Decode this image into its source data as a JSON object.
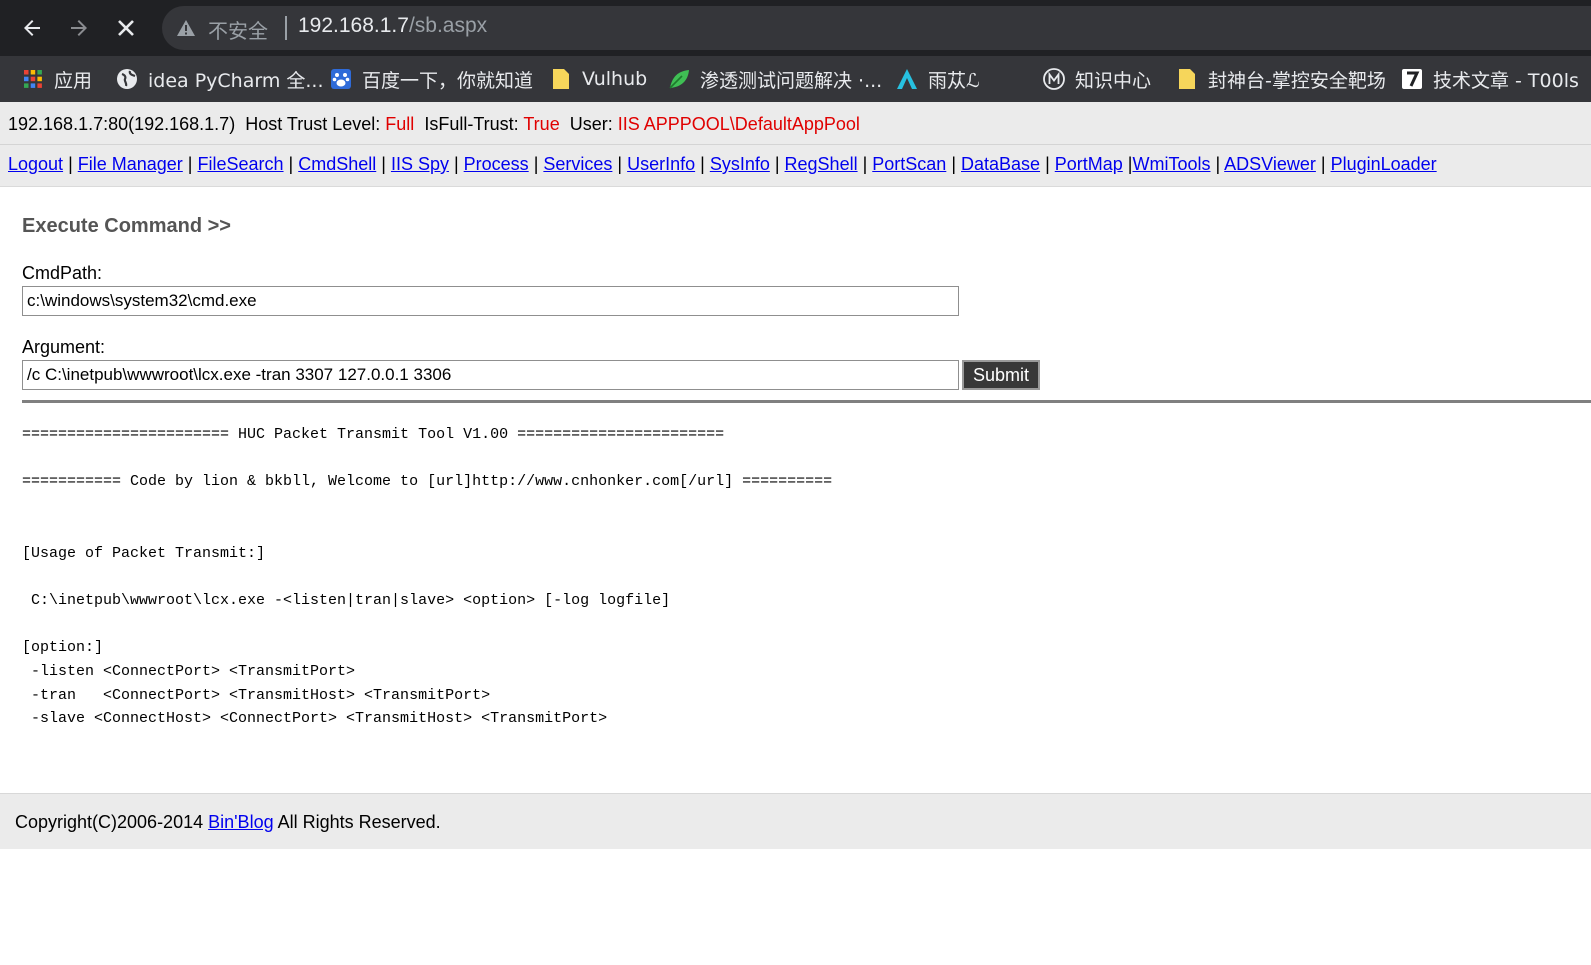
{
  "browser": {
    "security_label": "不安全",
    "url_host": "192.168.1.7",
    "url_path": "/sb.aspx",
    "bookmarks": [
      {
        "label": "应用",
        "icon": "apps-grid-icon"
      },
      {
        "label": "idea PyCharm 全...",
        "icon": "globe-icon"
      },
      {
        "label": "百度一下，你就知道",
        "icon": "baidu-paw-icon"
      },
      {
        "label": "Vulhub",
        "icon": "folder-icon"
      },
      {
        "label": "渗透测试问题解决 ·...",
        "icon": "leaf-icon"
      },
      {
        "label": "雨苁ℒ",
        "icon": "arrow-a-icon"
      },
      {
        "label": "知识中心",
        "icon": "m-circle-icon"
      },
      {
        "label": "封神台-掌控安全靶场",
        "icon": "folder-icon"
      },
      {
        "label": "技术文章 - T00ls",
        "icon": "seven-badge-icon"
      }
    ]
  },
  "info": {
    "host": "192.168.1.7:80(192.168.1.7)",
    "trust_label": "Host Trust Level:",
    "trust_value": "Full",
    "fulltrust_label": "IsFull-Trust:",
    "fulltrust_value": "True",
    "user_label": "User:",
    "user_value": "IIS APPPOOL\\DefaultAppPool"
  },
  "menu": [
    "Logout",
    "File Manager",
    "FileSearch",
    "CmdShell",
    "IIS Spy",
    "Process",
    "Services",
    "UserInfo",
    "SysInfo",
    "RegShell",
    "PortScan",
    "DataBase",
    "PortMap",
    "WmiTools",
    "ADSViewer",
    "PluginLoader"
  ],
  "command": {
    "title": "Execute Command >>",
    "cmdpath_label": "CmdPath:",
    "cmdpath_value": "c:\\windows\\system32\\cmd.exe",
    "argument_label": "Argument:",
    "argument_value": "/c C:\\inetpub\\wwwroot\\lcx.exe -tran 3307 127.0.0.1 3306",
    "submit_label": "Submit"
  },
  "output": "======================= HUC Packet Transmit Tool V1.00 =======================\n\n=========== Code by lion & bkbll, Welcome to [url]http://www.cnhonker.com[/url] ==========\n\n\n[Usage of Packet Transmit:]\n\n C:\\inetpub\\wwwroot\\lcx.exe -<listen|tran|slave> <option> [-log logfile]\n\n[option:]\n -listen <ConnectPort> <TransmitPort>\n -tran   <ConnectPort> <TransmitHost> <TransmitPort>\n -slave <ConnectHost> <ConnectPort> <TransmitHost> <TransmitPort>",
  "footer": {
    "prefix": "Copyright(C)2006-2014 ",
    "link": "Bin'Blog",
    "suffix": " All Rights Reserved."
  },
  "colors": {
    "chrome_dark": "#202124",
    "chrome_bar": "#35363a",
    "link": "#0000ee",
    "alert_red": "#e00000",
    "panel_gray": "#ebebeb"
  }
}
